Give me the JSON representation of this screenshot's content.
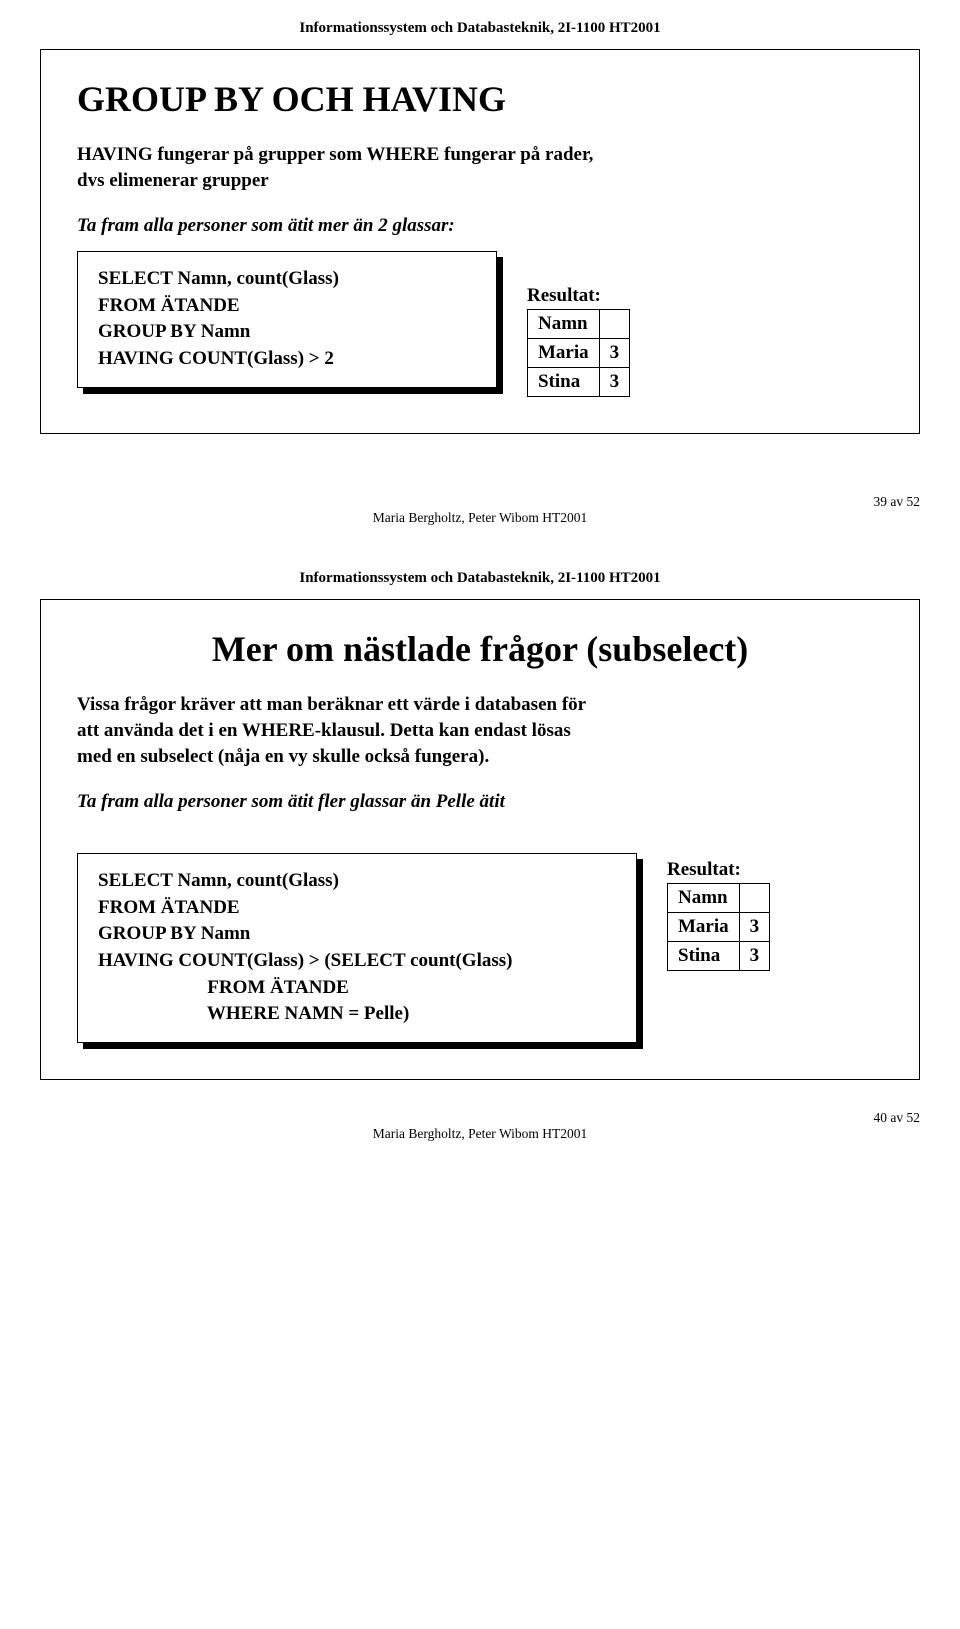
{
  "doc_header": "Informationssystem och Databasteknik, 2I-1100 HT2001",
  "footer_author": "Maria Bergholtz, Peter Wibom HT2001",
  "slide1": {
    "title": "GROUP BY OCH HAVING",
    "subtitle": "HAVING fungerar på grupper som WHERE fungerar på rader,\ndvs elimenerar grupper",
    "prompt": "Ta fram alla personer som ätit mer än 2 glassar:",
    "sql": "SELECT Namn, count(Glass)\nFROM ÄTANDE\nGROUP BY Namn\nHAVING COUNT(Glass) > 2",
    "result_label": "Resultat:",
    "result_head": "Namn",
    "rows": [
      {
        "name": "Maria",
        "val": "3"
      },
      {
        "name": "Stina",
        "val": "3"
      }
    ],
    "page": "39 av 52"
  },
  "slide2": {
    "title": "Mer om nästlade frågor (subselect)",
    "subtitle": "Vissa frågor kräver att man beräknar ett värde i databasen för\natt använda det i en WHERE-klausul. Detta kan endast lösas\nmed en subselect (nåja en vy skulle också fungera).",
    "prompt": "Ta fram alla personer som ätit fler glassar än Pelle ätit",
    "sql": "SELECT Namn, count(Glass)\nFROM ÄTANDE\nGROUP BY Namn\nHAVING COUNT(Glass) > (SELECT count(Glass)\n                       FROM ÄTANDE\n                       WHERE NAMN = Pelle)",
    "result_label": "Resultat:",
    "result_head": "Namn",
    "rows": [
      {
        "name": "Maria",
        "val": "3"
      },
      {
        "name": "Stina",
        "val": "3"
      }
    ],
    "page": "40 av 52"
  }
}
